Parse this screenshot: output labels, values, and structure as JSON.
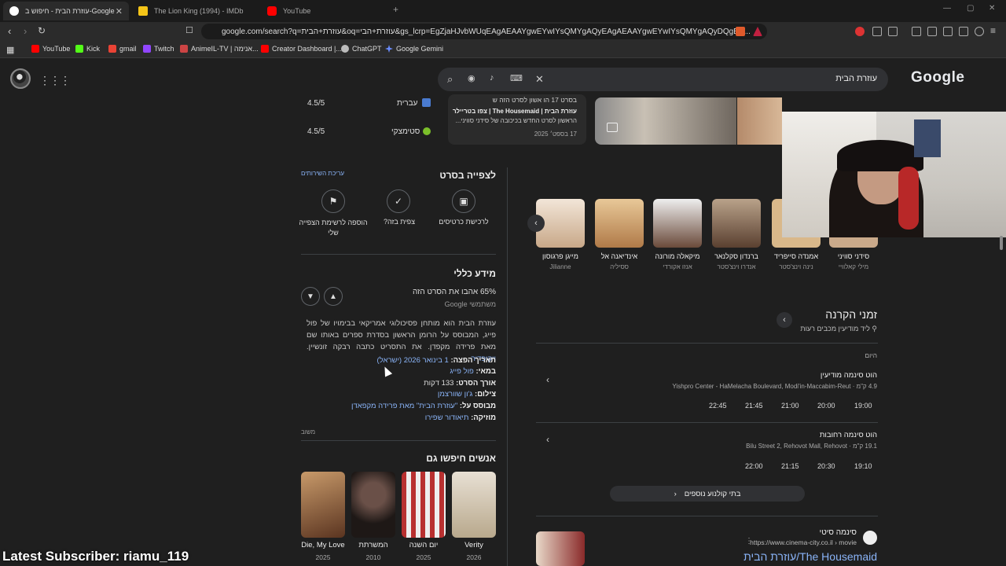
{
  "browser": {
    "tabs": [
      {
        "label": "עוזרת הבית - חיפוש ב-Google",
        "icon": "google-icon"
      },
      {
        "label": "The Lion King (1994) - IMDb",
        "icon": "imdb-icon"
      },
      {
        "label": "YouTube",
        "icon": "youtube-icon"
      }
    ],
    "new_tab": "+",
    "url": "google.com/search?q=עוזרת+הבית&oq=עוזרת+הבי&gs_lcrp=EgZjaHJvbWUqEAgAEAAYgwEYwIYsQMYgAQyEAgAEAAYgwEYwIYsQMYgAQyDQgBE...",
    "bookmarks": [
      "YouTube",
      "Kick",
      "gmail",
      "Twitch",
      "AnimeIL-TV | אנימה...",
      "Creator Dashboard |...",
      "ChatGPT",
      "Google Gemini"
    ]
  },
  "google": {
    "query": "עוזרת הבית",
    "logo": "Google"
  },
  "top_strip": {
    "ratings": [
      {
        "source": "עברית",
        "score": "4.5/5"
      },
      {
        "source": "סטימצקי",
        "score": "4.5/5"
      }
    ],
    "news": {
      "line1": "בסרט 17 הו אשון לסרט הזה ש",
      "line2": "עוזרת הבית | The Housemaid | צפו בטריילר",
      "line3": "הראשון לסרט החדש בכיכובה של סידני סוויני...",
      "date": "17 בספט׳ 2025"
    }
  },
  "watch": {
    "title": "לצפייה בסרט",
    "edit_link": "עריכת השירותים",
    "actions": [
      {
        "label": "לרכישת כרטיסים",
        "icon": "ticket-icon"
      },
      {
        "label": "צפית בזה?",
        "icon": "check-icon"
      },
      {
        "label": "הוספה לרשימת הצפייה שלי",
        "icon": "bookmark-icon"
      }
    ]
  },
  "general_info": {
    "title": "מידע כללי",
    "liked": "65% אהבו את הסרט הזה",
    "liked_source": "משתמשי Google",
    "description": "עוזרת הבית הוא מותחן פסיכולוגי אמריקאי בבימויו של פול פייג, המבוסס על הרומן הראשון בסדרת ספרים באותו שם מאת פרידה מקפדן. את התסריט כתבה רבקה זונשיין.",
    "wiki": "ויקיפדיה",
    "facts": [
      {
        "label": "תאריך הפצה:",
        "value": "1 בינואר 2026 (ישראל)"
      },
      {
        "label": "במאי:",
        "value": "פול פייג"
      },
      {
        "label": "אורך הסרט:",
        "value": "133 דקות"
      },
      {
        "label": "צילום:",
        "value": "ג'ון שוורצמן"
      },
      {
        "label": "מבוסס על:",
        "value": "\"עוזרת הבית\" מאת פרידה מקפאדן"
      },
      {
        "label": "מוזיקה:",
        "value": "תיאודור שפירו"
      }
    ],
    "feedback": "משוב"
  },
  "people_also_search": {
    "title": "אנשים חיפשו גם",
    "movies": [
      {
        "title": "Verity",
        "year": "2026",
        "color": "#c9b89a"
      },
      {
        "title": "יום השנה",
        "year": "2025",
        "color": "#6b3b3b"
      },
      {
        "title": "המשרתת",
        "year": "2010",
        "color": "#2a2422"
      },
      {
        "title": "Die, My Love",
        "year": "2025",
        "color": "#8a5a3a"
      }
    ]
  },
  "cast": [
    {
      "name": "סידני סוויני",
      "role": "מילי קאלוויי",
      "color": "#c9a98a"
    },
    {
      "name": "אמנדה סייפריד",
      "role": "נינה וינצ'סטר",
      "color": "#d9b88a"
    },
    {
      "name": "ברנדון סקלנאר",
      "role": "אנדרו וינצ'סטר",
      "color": "#7a5a48"
    },
    {
      "name": "מיקאלה מורונה",
      "role": "אנזו אקורדי",
      "color": "#6a4a3a"
    },
    {
      "name": "אינדיאנה אל",
      "role": "ססיליה",
      "color": "#d9a878"
    },
    {
      "name": "מייגן פרגוסון",
      "role": "Jilianne",
      "color": "#e2d2c2"
    }
  ],
  "showtimes": {
    "title": "זמני הקרנה",
    "location": "ליד מודיעין מכבים רעות",
    "day": "היום",
    "theaters": [
      {
        "name": "הוט סינמה מודיעין",
        "address": "4.9 ק\"מ · Yishpro Center - HaMelacha Boulevard, Modi'in-Maccabim-Reut",
        "times": [
          "19:00",
          "20:00",
          "21:00",
          "21:45",
          "22:45"
        ]
      },
      {
        "name": "הוט סינמה רחובות",
        "address": "19.1 ק\"מ · Bilu Street 2, Rehovot Mall, Rehovot",
        "times": [
          "19:10",
          "20:30",
          "21:15",
          "22:00"
        ]
      }
    ],
    "more": "בתי קולנוע נוספים"
  },
  "result": {
    "site": "סינמה סיטי",
    "url": "https://www.cinema-city.co.il › movie",
    "title": "עוזרת הבית/The Housemaid"
  },
  "stream_overlay": "Latest Subscriber: riamu_119"
}
